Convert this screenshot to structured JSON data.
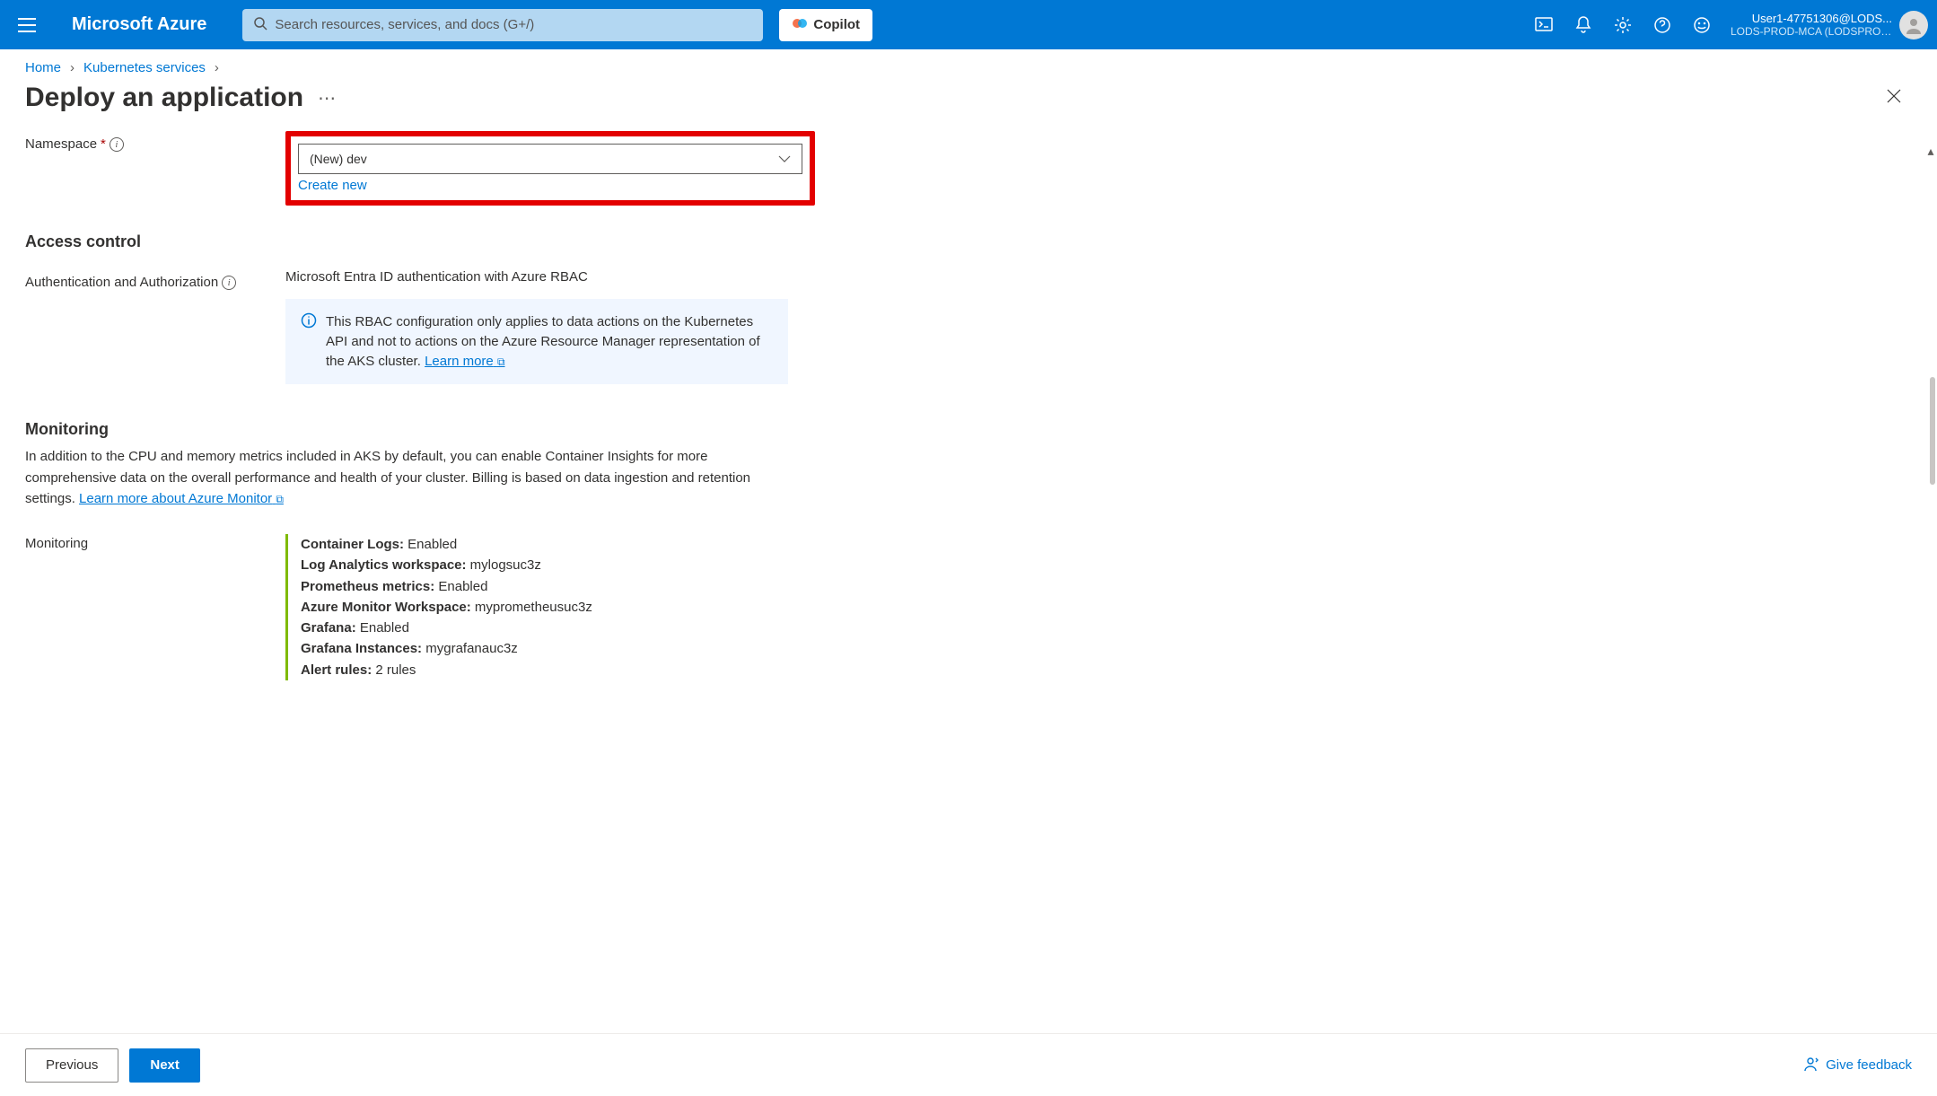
{
  "header": {
    "brand": "Microsoft Azure",
    "search_placeholder": "Search resources, services, and docs (G+/)",
    "copilot": "Copilot",
    "user_line1": "User1-47751306@LODS...",
    "user_line2": "LODS-PROD-MCA (LODSPRODM..."
  },
  "breadcrumb": {
    "home": "Home",
    "k8s": "Kubernetes services"
  },
  "page": {
    "title": "Deploy an application"
  },
  "form": {
    "namespace_label": "Namespace",
    "namespace_value": "(New) dev",
    "create_new": "Create new"
  },
  "access": {
    "heading": "Access control",
    "auth_label": "Authentication and Authorization",
    "auth_value": "Microsoft Entra ID authentication with Azure RBAC",
    "info_text": "This RBAC configuration only applies to data actions on the Kubernetes API and not to actions on the Azure Resource Manager representation of the AKS cluster. ",
    "learn_more": "Learn more"
  },
  "monitoring": {
    "heading": "Monitoring",
    "desc_prefix": "In addition to the CPU and memory metrics included in AKS by default, you can enable Container Insights for more comprehensive data on the overall performance and health of your cluster. Billing is based on data ingestion and retention settings. ",
    "learn_link": "Learn more about Azure Monitor",
    "label": "Monitoring",
    "lines": {
      "container_logs_k": "Container Logs:",
      "container_logs_v": "Enabled",
      "law_k": "Log Analytics workspace:",
      "law_v": "mylogsuc3z",
      "prom_k": "Prometheus metrics:",
      "prom_v": "Enabled",
      "amw_k": "Azure Monitor Workspace:",
      "amw_v": "myprometheusuc3z",
      "grafana_k": "Grafana:",
      "grafana_v": "Enabled",
      "gi_k": "Grafana Instances:",
      "gi_v": "mygrafanauc3z",
      "alert_k": "Alert rules:",
      "alert_v": "2 rules"
    }
  },
  "footer": {
    "previous": "Previous",
    "next": "Next",
    "feedback": "Give feedback"
  }
}
